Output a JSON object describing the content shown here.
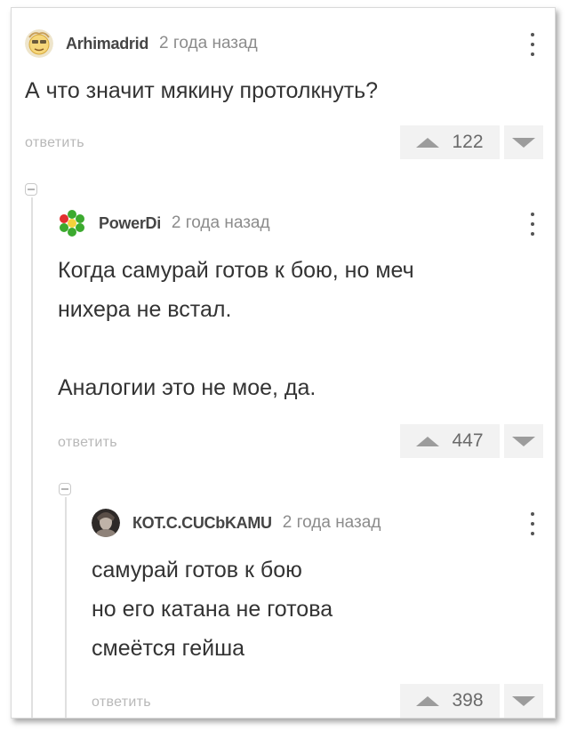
{
  "reply_label": "ответить",
  "comments": [
    {
      "author": "Arhimadrid",
      "time": "2 года назад",
      "text": "А что значит мякину протолкнуть?",
      "votes": "122",
      "avatar_icon": "smiley-avatar-icon"
    },
    {
      "author": "PowerDi",
      "time": "2 года назад",
      "text": "Когда самурай готов к бою, но меч\nнихера не встал.\n\nАналогии это не мое, да.",
      "votes": "447",
      "avatar_icon": "icq-flower-icon"
    },
    {
      "author": "КОТ.С.СUCbKAMU",
      "time": "2 года назад",
      "text": "самурай готов к бою\nно его катана не готова\nсмеётся гейша",
      "votes": "398",
      "avatar_icon": "photo-avatar-icon"
    }
  ]
}
